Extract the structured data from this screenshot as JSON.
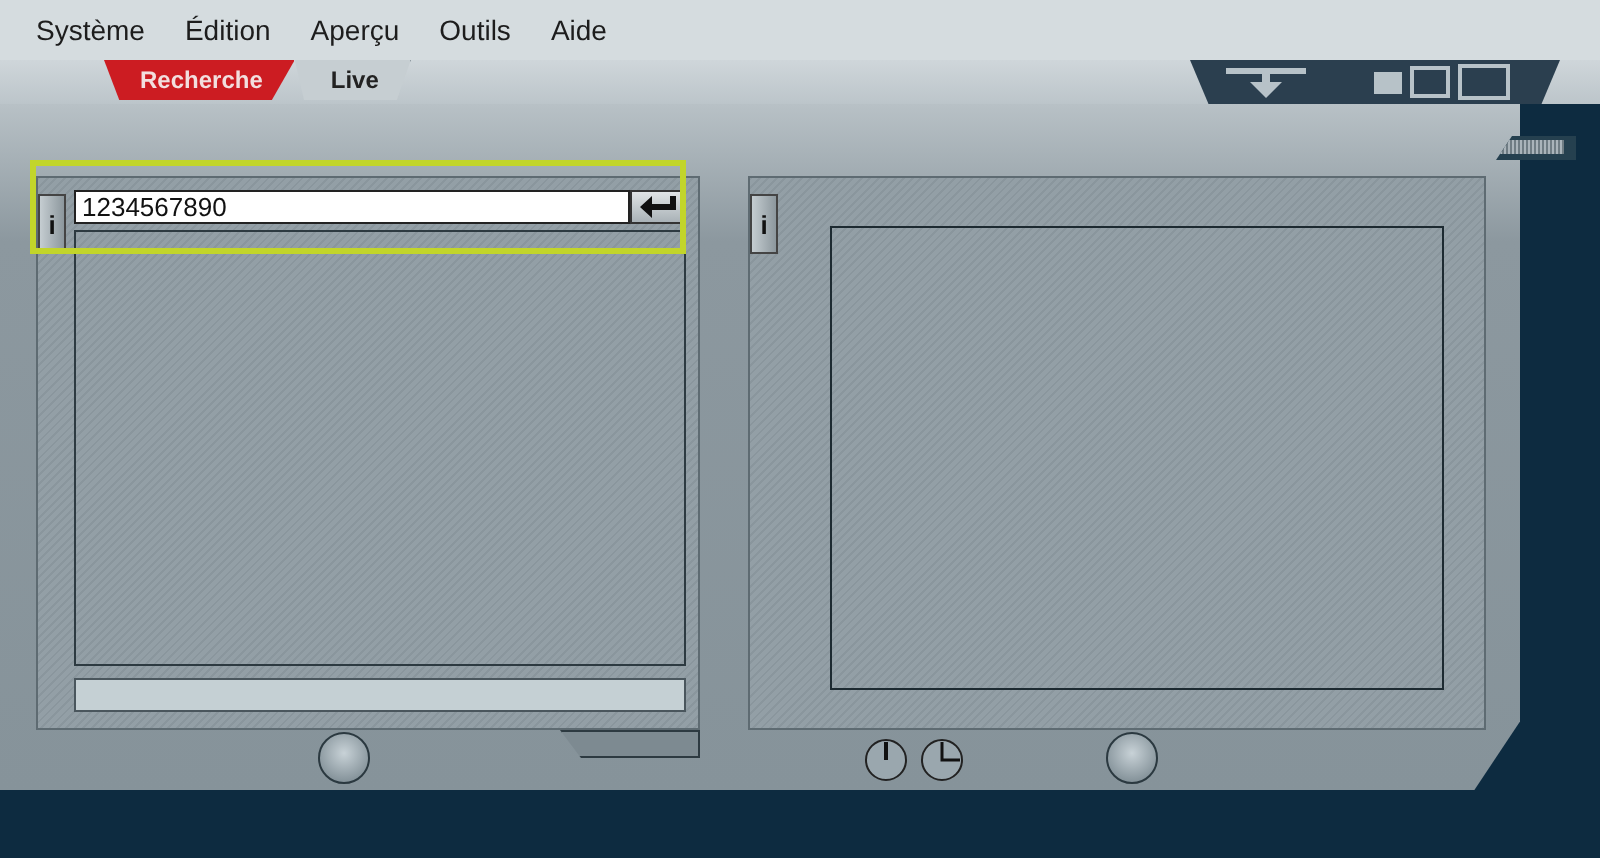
{
  "menu": [
    "Système",
    "Édition",
    "Aperçu",
    "Outils",
    "Aide"
  ],
  "tabs": [
    {
      "label": "Recherche",
      "selected": true
    },
    {
      "label": "Live",
      "selected": false
    }
  ],
  "search_panel": {
    "info": "i",
    "field": {
      "value": "1234567890"
    },
    "highlighted": true
  },
  "viewer_panel": {
    "info": "i"
  }
}
